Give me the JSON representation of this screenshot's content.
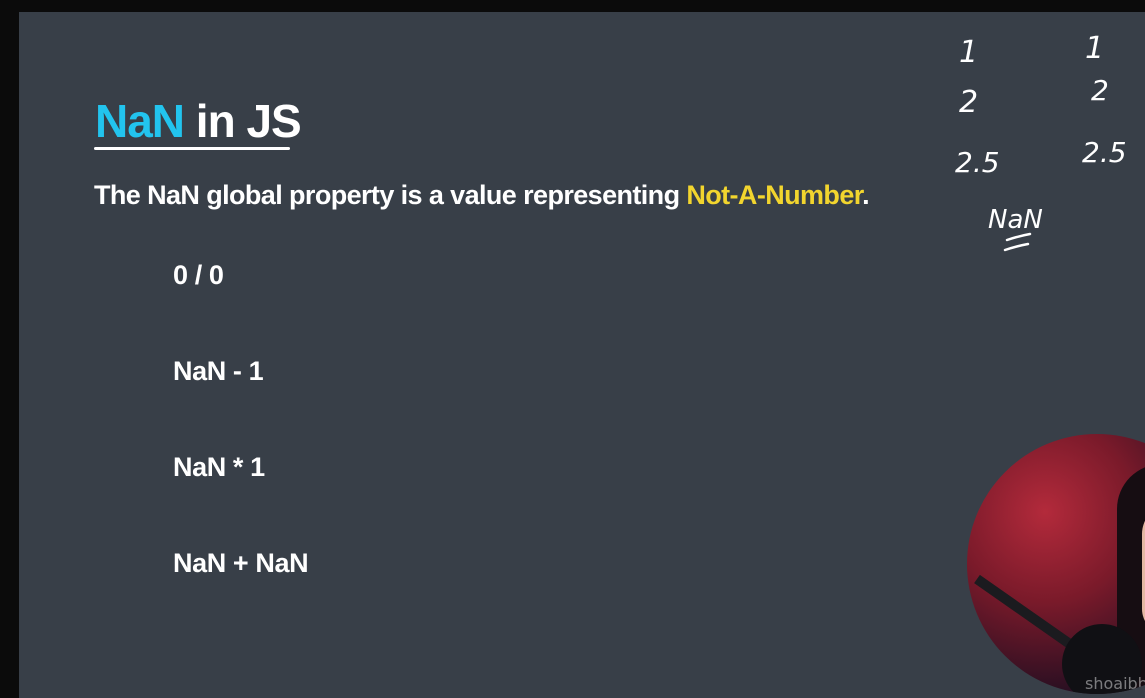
{
  "slide": {
    "title_highlight": "NaN",
    "title_rest": " in JS",
    "definition_prefix": "The NaN global property is a value representing ",
    "definition_highlight": "Not-A-Number",
    "definition_suffix": ".",
    "expressions": [
      "0 / 0",
      "NaN - 1",
      "NaN * 1",
      "NaN + NaN"
    ]
  },
  "handwriting": {
    "left_column": [
      "1",
      "2",
      "2.5"
    ],
    "right_column": [
      "1",
      "2",
      "2.5"
    ],
    "note": "NaN"
  },
  "webcam": {
    "watermark": "shoaibba"
  },
  "colors": {
    "slide_background": "#383f48",
    "title_accent": "#22c4ee",
    "definition_highlight": "#f2d52e",
    "text": "#ffffff"
  }
}
